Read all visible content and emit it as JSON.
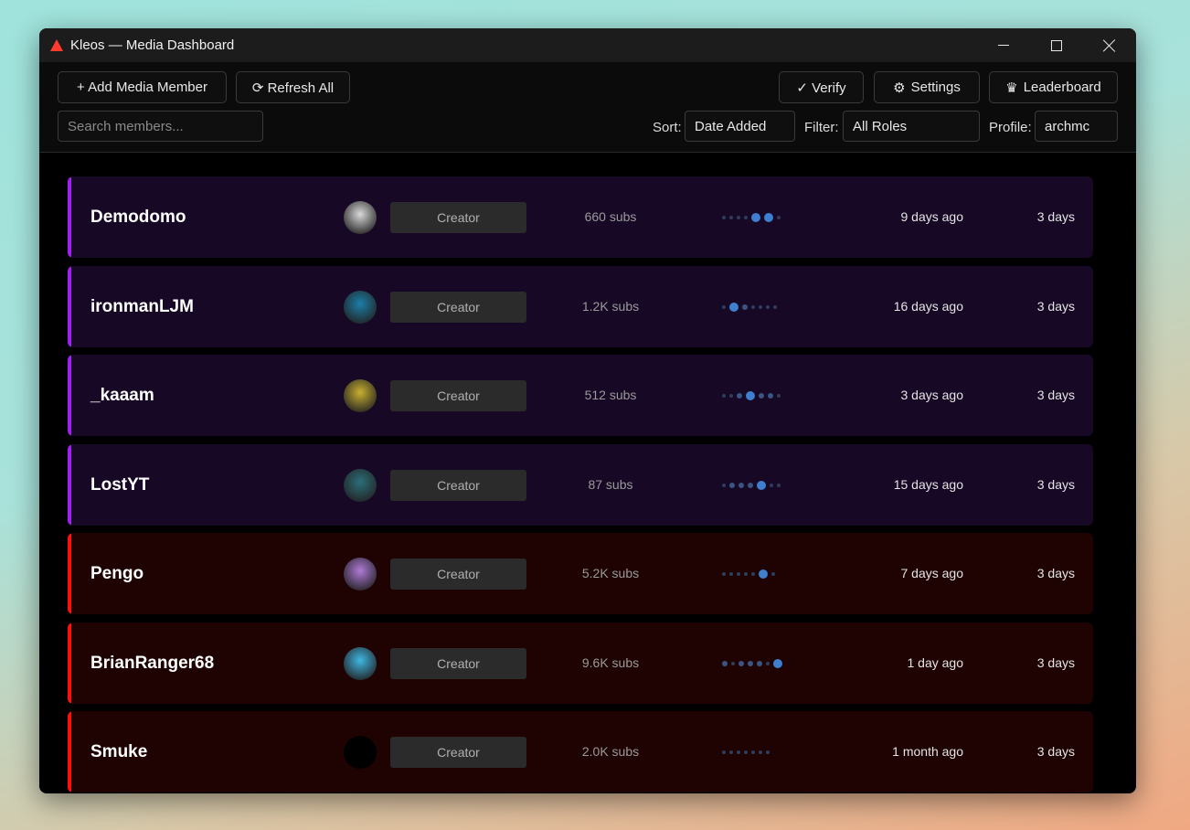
{
  "window": {
    "title": "Kleos — Media Dashboard"
  },
  "toolbar": {
    "add_label": "+ Add Media Member",
    "refresh_label": "⟳ Refresh All",
    "verify_label": "✓ Verify",
    "settings_label": "Settings",
    "leaderboard_label": "Leaderboard",
    "search_placeholder": "Search members...",
    "sort_label": "Sort:",
    "sort_value": "Date Added",
    "filter_label": "Filter:",
    "filter_value": "All Roles",
    "profile_label": "Profile:",
    "profile_value": "archmc"
  },
  "members": [
    {
      "name": "Demodomo",
      "role": "Creator",
      "subs": "660 subs",
      "last": "9 days ago",
      "duration": "3 days",
      "theme": "purple",
      "activity": [
        0,
        0,
        0,
        0,
        2,
        2,
        0
      ],
      "avatar_color": "#d9d9d9"
    },
    {
      "name": "ironmanLJM",
      "role": "Creator",
      "subs": "1.2K subs",
      "last": "16 days ago",
      "duration": "3 days",
      "theme": "purple",
      "activity": [
        0,
        2,
        1,
        0,
        0,
        0,
        0
      ],
      "avatar_color": "#1b7fa8"
    },
    {
      "name": "_kaaam",
      "role": "Creator",
      "subs": "512 subs",
      "last": "3 days ago",
      "duration": "3 days",
      "theme": "purple",
      "activity": [
        0,
        0,
        1,
        2,
        1,
        1,
        0
      ],
      "avatar_color": "#c8b030"
    },
    {
      "name": "LostYT",
      "role": "Creator",
      "subs": "87 subs",
      "last": "15 days ago",
      "duration": "3 days",
      "theme": "purple",
      "activity": [
        0,
        1,
        1,
        1,
        2,
        0,
        0
      ],
      "avatar_color": "#2b6f7a"
    },
    {
      "name": "Pengo",
      "role": "Creator",
      "subs": "5.2K subs",
      "last": "7 days ago",
      "duration": "3 days",
      "theme": "red",
      "activity": [
        0,
        0,
        0,
        0,
        0,
        2,
        0
      ],
      "avatar_color": "#b07ad8"
    },
    {
      "name": "BrianRanger68",
      "role": "Creator",
      "subs": "9.6K subs",
      "last": "1 day ago",
      "duration": "3 days",
      "theme": "red",
      "activity": [
        1,
        0,
        1,
        1,
        1,
        0,
        2
      ],
      "avatar_color": "#3fb7e3"
    },
    {
      "name": "Smuke",
      "role": "Creator",
      "subs": "2.0K subs",
      "last": "1 month ago",
      "duration": "3 days",
      "theme": "red",
      "activity": [
        0,
        0,
        0,
        0,
        0,
        0,
        0
      ],
      "avatar_color": "#000000"
    }
  ]
}
